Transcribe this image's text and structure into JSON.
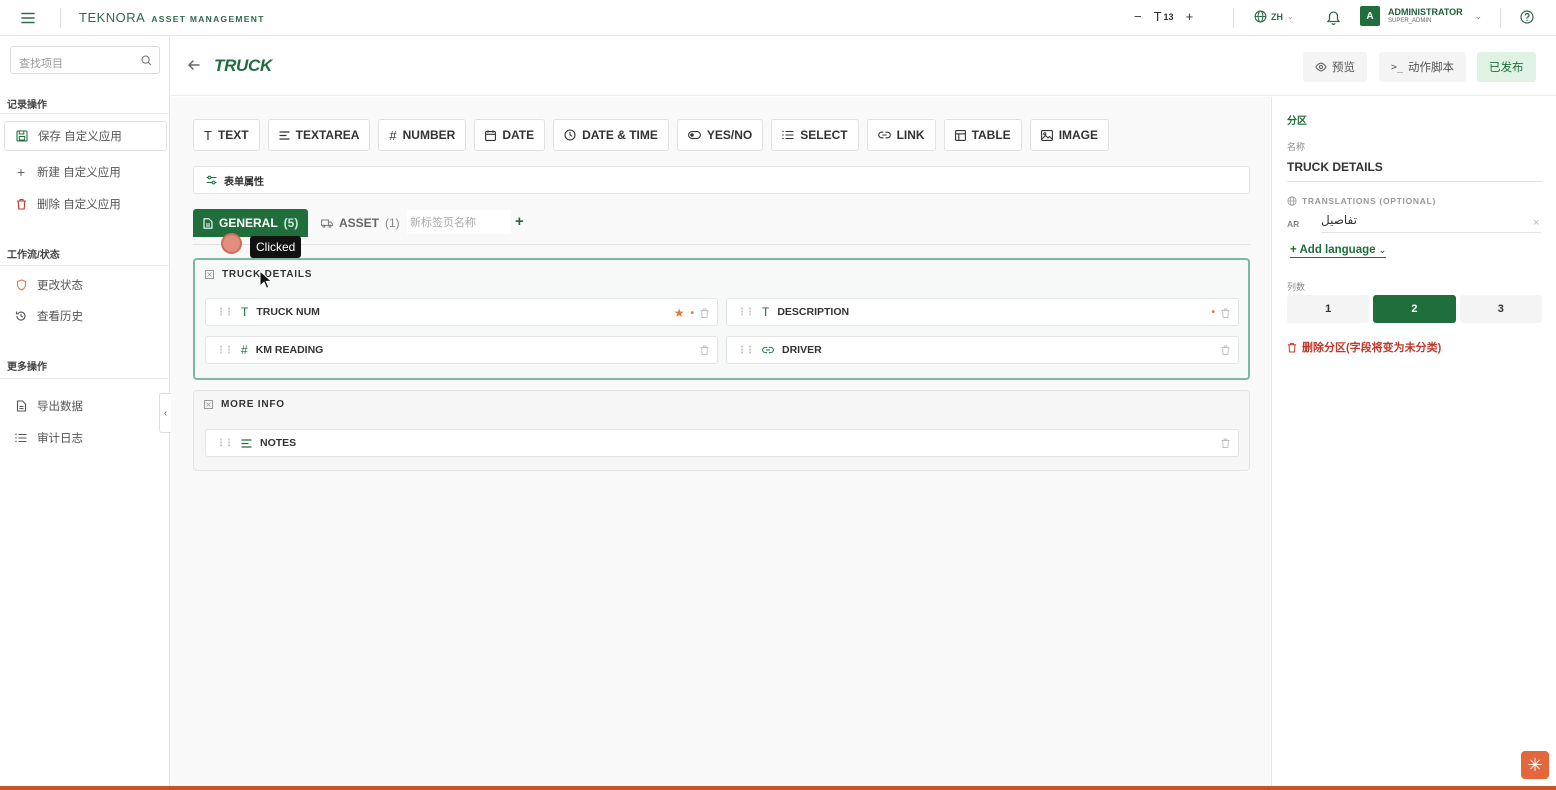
{
  "topbar": {
    "brand_name": "TEKNORA",
    "brand_sub": "ASSET MANAGEMENT",
    "font_size": "13",
    "language": "ZH",
    "user_initial": "A",
    "user_name": "ADMINISTRATOR",
    "user_role": "SUPER_ADMIN"
  },
  "sidebar": {
    "search_placeholder": "查找项目",
    "record_heading": "记录操作",
    "save_label": "保存 自定义应用",
    "new_label": "新建 自定义应用",
    "delete_label": "删除 自定义应用",
    "workflow_heading": "工作流/状态",
    "change_status_label": "更改状态",
    "history_label": "查看历史",
    "more_heading": "更多操作",
    "export_label": "导出数据",
    "audit_label": "审计日志"
  },
  "header": {
    "title": "TRUCK",
    "preview_label": "预览",
    "script_label": "动作脚本",
    "publish_label": "已发布"
  },
  "toolbox": [
    {
      "label": "TEXT",
      "icon": "text-icon"
    },
    {
      "label": "TEXTAREA",
      "icon": "textarea-icon"
    },
    {
      "label": "NUMBER",
      "icon": "hash-icon"
    },
    {
      "label": "DATE",
      "icon": "calendar-icon"
    },
    {
      "label": "DATE & TIME",
      "icon": "clock-icon"
    },
    {
      "label": "YES/NO",
      "icon": "toggle-icon"
    },
    {
      "label": "SELECT",
      "icon": "list-icon"
    },
    {
      "label": "LINK",
      "icon": "link-icon"
    },
    {
      "label": "TABLE",
      "icon": "table-icon"
    },
    {
      "label": "IMAGE",
      "icon": "image-icon"
    }
  ],
  "form_props_label": "表单属性",
  "tabs": {
    "active_label": "GENERAL",
    "active_count": "(5)",
    "second_label": "ASSET",
    "second_count": "(1)",
    "new_placeholder": "新标签页名称",
    "add": "+"
  },
  "tooltip": "Clicked",
  "sections": {
    "truck_details_title": "TRUCK DETAILS",
    "more_info_title": "MORE INFO",
    "fields": {
      "truck_num": "TRUCK NUM",
      "description": "DESCRIPTION",
      "km_reading": "KM READING",
      "driver": "DRIVER",
      "notes": "NOTES"
    }
  },
  "panel": {
    "section_heading": "分区",
    "name_label": "名称",
    "name_value": "TRUCK DETAILS",
    "translations_label": "TRANSLATIONS (OPTIONAL)",
    "ar_code": "AR",
    "ar_value": "تفاصيل",
    "add_language": "+ Add language",
    "columns_label": "列数",
    "columns": [
      "1",
      "2",
      "3"
    ],
    "active_columns": "2",
    "delete_section": "删除分区(字段将变为未分类)"
  },
  "colors": {
    "brand_green": "#1f6e3c",
    "selected_border": "#7bb7a2",
    "danger": "#c0392b",
    "required": "#e07a3c"
  }
}
